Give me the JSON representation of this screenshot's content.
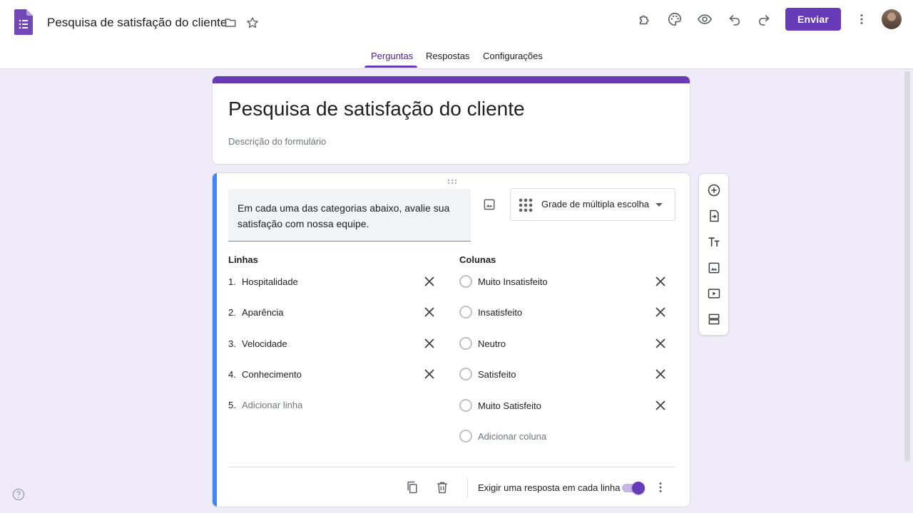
{
  "header": {
    "doc_title": "Pesquisa de satisfação do cliente",
    "send_label": "Enviar",
    "icons": [
      "forms-logo",
      "folder-icon",
      "star-icon",
      "addon-icon",
      "palette-icon",
      "preview-icon",
      "undo-icon",
      "redo-icon",
      "more-vert-icon",
      "avatar"
    ]
  },
  "tabs": [
    {
      "label": "Perguntas",
      "active": true
    },
    {
      "label": "Respostas",
      "active": false
    },
    {
      "label": "Configurações",
      "active": false
    }
  ],
  "form": {
    "title": "Pesquisa de satisfação do cliente",
    "description_placeholder": "Descrição do formulário"
  },
  "question": {
    "text": "Em cada uma das categorias abaixo, avalie sua satisfação com nossa equipe.",
    "type": "Grade de múltipla escolha",
    "rows_heading": "Linhas",
    "columns_heading": "Colunas",
    "rows": [
      {
        "num": "1.",
        "label": "Hospitalidade"
      },
      {
        "num": "2.",
        "label": "Aparência"
      },
      {
        "num": "3.",
        "label": "Velocidade"
      },
      {
        "num": "4.",
        "label": "Conhecimento"
      }
    ],
    "add_row": {
      "num": "5.",
      "label": "Adicionar linha"
    },
    "columns": [
      {
        "label": "Muito Insatisfeito"
      },
      {
        "label": "Insatisfeito"
      },
      {
        "label": "Neutro"
      },
      {
        "label": "Satisfeito"
      },
      {
        "label": "Muito Satisfeito"
      }
    ],
    "add_column": "Adicionar coluna",
    "require_label": "Exigir uma resposta em cada linha",
    "require_enabled": true
  },
  "colors": {
    "accent": "#673ab7",
    "background": "#f0ebf8",
    "question_bar": "#4285f4"
  }
}
